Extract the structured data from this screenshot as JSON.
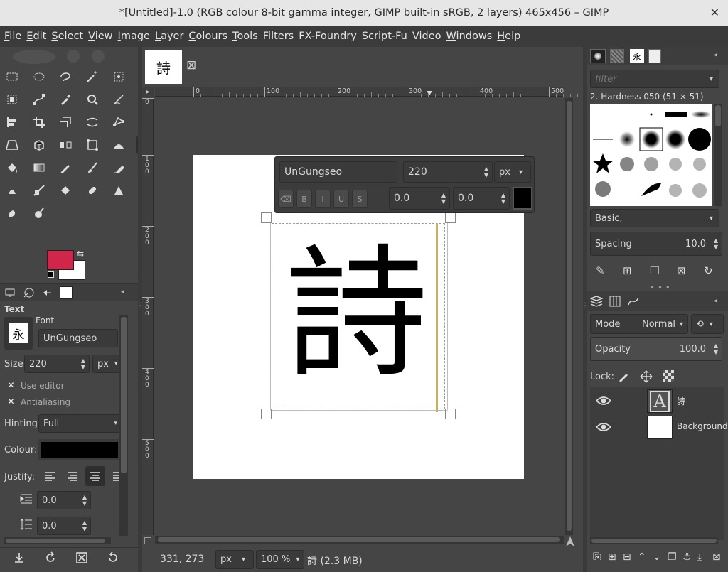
{
  "window": {
    "title": "*[Untitled]-1.0 (RGB colour 8-bit gamma integer, GIMP built-in sRGB, 2 layers) 465x456 – GIMP",
    "close_glyph": "✕"
  },
  "menu": [
    {
      "label": "File",
      "key": "F",
      "rest": "ile"
    },
    {
      "label": "Edit",
      "key": "E",
      "rest": "dit"
    },
    {
      "label": "Select",
      "key": "S",
      "rest": "elect"
    },
    {
      "label": "View",
      "key": "V",
      "rest": "iew"
    },
    {
      "label": "Image",
      "key": "I",
      "rest": "mage"
    },
    {
      "label": "Layer",
      "key": "L",
      "rest": "ayer"
    },
    {
      "label": "Colours",
      "key": "C",
      "rest": "olours"
    },
    {
      "label": "Tools",
      "key": "T",
      "rest": "ools"
    },
    {
      "label": "Filters",
      "key": "",
      "rest": "Filters"
    },
    {
      "label": "FX-Foundry",
      "key": "",
      "rest": "FX-Foundry"
    },
    {
      "label": "Script-Fu",
      "key": "",
      "rest": "Script-Fu"
    },
    {
      "label": "Video",
      "key": "",
      "rest": "Video"
    },
    {
      "label": "Windows",
      "key": "W",
      "rest": "indows"
    },
    {
      "label": "Help",
      "key": "H",
      "rest": "elp"
    }
  ],
  "image_tab": {
    "thumb_char": "詩",
    "close": "⊠"
  },
  "colors": {
    "foreground": "#d0264a",
    "background": "#ffffff",
    "accent_line": "#c8b060"
  },
  "tool_options": {
    "tab_title": "Text",
    "font_label": "Font",
    "font_value": "UnGungseo",
    "font_preview": "永",
    "size_label": "Size:",
    "size_value": "220",
    "size_unit": "px",
    "use_editor": "Use editor",
    "antialiasing": "Antialiasing",
    "hinting_label": "Hinting:",
    "hinting_value": "Full",
    "colour_label": "Colour:",
    "justify_label": "Justify:",
    "indent_value": "0.0",
    "line_spacing_value": "0.0"
  },
  "ruler": {
    "h_labels": [
      "0",
      "100",
      "200",
      "300",
      "400",
      "500"
    ],
    "v_labels": [
      "0",
      "1\n0\n0",
      "2\n0\n0",
      "3\n0\n0",
      "4\n0\n0",
      "5\n0\n0"
    ]
  },
  "text_toolbar": {
    "font": "UnGungseo",
    "size": "220",
    "unit": "px",
    "baseline": "0.0",
    "kerning": "0.0"
  },
  "canvas_text": "詩",
  "status": {
    "coords": "331, 273",
    "unit": "px",
    "zoom": "100 %",
    "info": "詩 (2.3 MB)"
  },
  "brushes": {
    "filter_placeholder": "filter",
    "selected": "2. Hardness 050 (51 × 51)",
    "preset": "Basic,",
    "spacing_label": "Spacing",
    "spacing_value": "10.0"
  },
  "layers_panel": {
    "mode_label": "Mode",
    "mode_value": "Normal",
    "opacity_label": "Opacity",
    "opacity_value": "100.0",
    "lock_label": "Lock:",
    "layers": [
      {
        "name": "詩",
        "type": "text"
      },
      {
        "name": "Background",
        "type": "image"
      }
    ]
  }
}
